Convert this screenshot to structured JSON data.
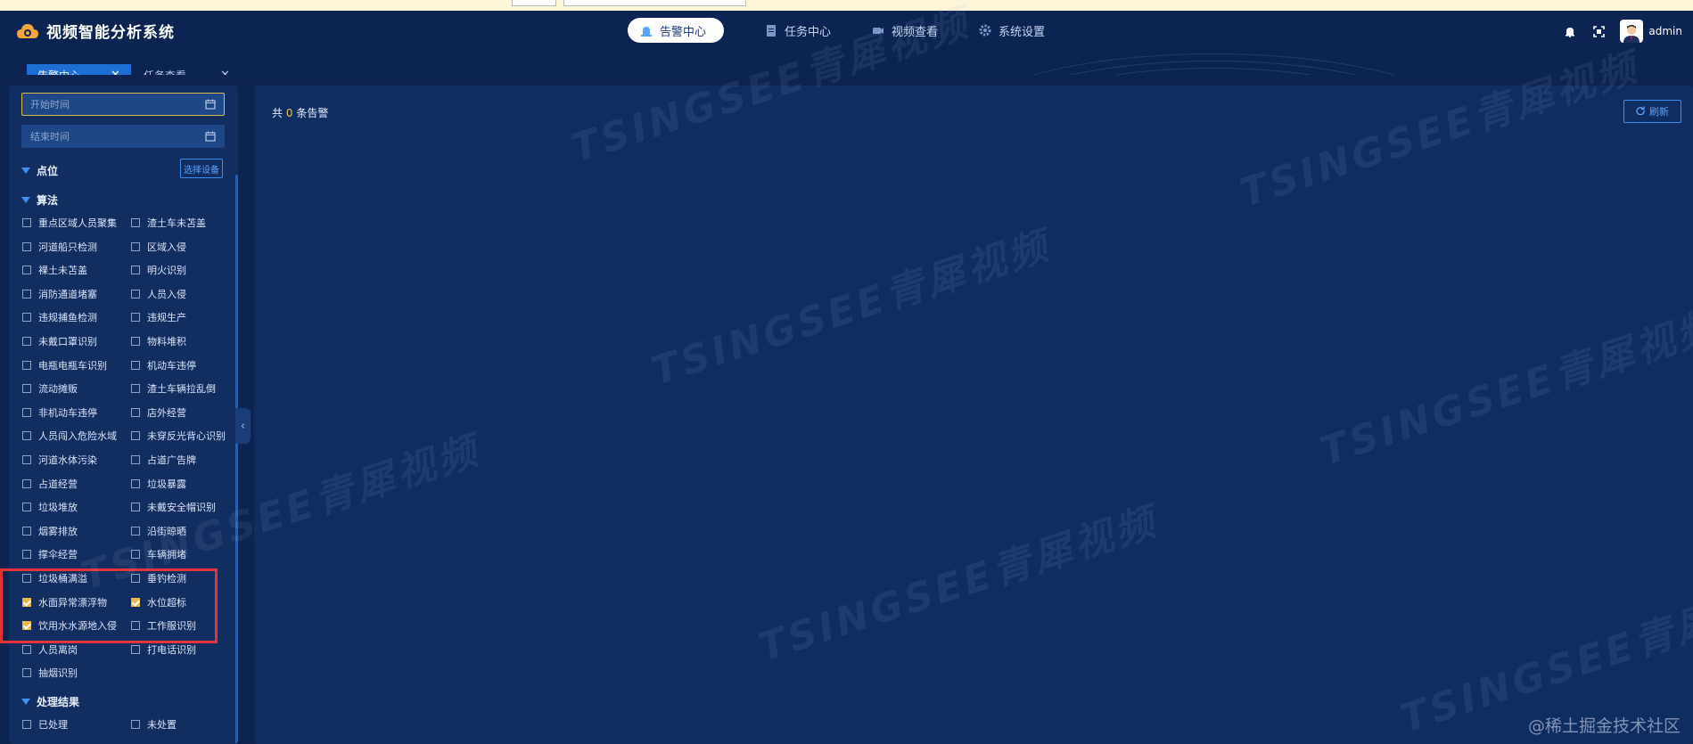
{
  "app": {
    "title": "视频智能分析系统"
  },
  "nav": {
    "items": [
      {
        "label": "告警中心",
        "icon": "alarm-icon",
        "active": true
      },
      {
        "label": "任务中心",
        "icon": "clipboard-icon",
        "active": false
      },
      {
        "label": "视频查看",
        "icon": "camera-icon",
        "active": false
      },
      {
        "label": "系统设置",
        "icon": "gear-icon",
        "active": false
      }
    ]
  },
  "user": {
    "name": "admin"
  },
  "tabs": [
    {
      "label": "告警中心",
      "active": true
    },
    {
      "label": "任务查看",
      "active": false
    }
  ],
  "filters": {
    "start_time_placeholder": "开始时间",
    "end_time_placeholder": "结束时间",
    "location_label": "点位",
    "select_device_label": "选择设备",
    "algorithm_label": "算法",
    "algorithms": [
      {
        "label": "重点区域人员聚集",
        "checked": false
      },
      {
        "label": "渣土车未苫盖",
        "checked": false
      },
      {
        "label": "河道船只检测",
        "checked": false
      },
      {
        "label": "区域入侵",
        "checked": false
      },
      {
        "label": "裸土未苫盖",
        "checked": false
      },
      {
        "label": "明火识别",
        "checked": false
      },
      {
        "label": "消防通道堵塞",
        "checked": false
      },
      {
        "label": "人员入侵",
        "checked": false
      },
      {
        "label": "违规捕鱼检测",
        "checked": false
      },
      {
        "label": "违规生产",
        "checked": false
      },
      {
        "label": "未戴口罩识别",
        "checked": false
      },
      {
        "label": "物料堆积",
        "checked": false
      },
      {
        "label": "电瓶电瓶车识别",
        "checked": false
      },
      {
        "label": "机动车违停",
        "checked": false
      },
      {
        "label": "流动摊贩",
        "checked": false
      },
      {
        "label": "渣土车辆拉乱倒",
        "checked": false
      },
      {
        "label": "非机动车违停",
        "checked": false
      },
      {
        "label": "店外经营",
        "checked": false
      },
      {
        "label": "人员闯入危险水域",
        "checked": false
      },
      {
        "label": "未穿反光背心识别",
        "checked": false
      },
      {
        "label": "河道水体污染",
        "checked": false
      },
      {
        "label": "占道广告牌",
        "checked": false
      },
      {
        "label": "占道经营",
        "checked": false
      },
      {
        "label": "垃圾暴露",
        "checked": false
      },
      {
        "label": "垃圾堆放",
        "checked": false
      },
      {
        "label": "未戴安全帽识别",
        "checked": false
      },
      {
        "label": "烟雾排放",
        "checked": false
      },
      {
        "label": "沿街晾晒",
        "checked": false
      },
      {
        "label": "撑伞经营",
        "checked": false
      },
      {
        "label": "车辆拥堵",
        "checked": false
      },
      {
        "label": "垃圾桶满溢",
        "checked": false
      },
      {
        "label": "垂钓检测",
        "checked": false
      },
      {
        "label": "水面异常漂浮物",
        "checked": true
      },
      {
        "label": "水位超标",
        "checked": true
      },
      {
        "label": "饮用水水源地入侵",
        "checked": true
      },
      {
        "label": "工作服识别",
        "checked": false
      },
      {
        "label": "人员离岗",
        "checked": false
      },
      {
        "label": "打电话识别",
        "checked": false
      },
      {
        "label": "抽烟识别",
        "checked": false
      }
    ],
    "result_label": "处理结果",
    "results": [
      {
        "label": "已处理",
        "checked": false
      },
      {
        "label": "未处置",
        "checked": false
      }
    ]
  },
  "main": {
    "count_prefix": "共",
    "count": "0",
    "count_suffix": "条告警",
    "refresh_label": "刷新"
  },
  "watermark": "TSINGSEE青犀视频",
  "credit": "@稀土掘金技术社区",
  "colors": {
    "accent": "#1d6fd6",
    "check": "#e8b94a",
    "highlight": "#e5333a",
    "background": "#0d2350"
  }
}
